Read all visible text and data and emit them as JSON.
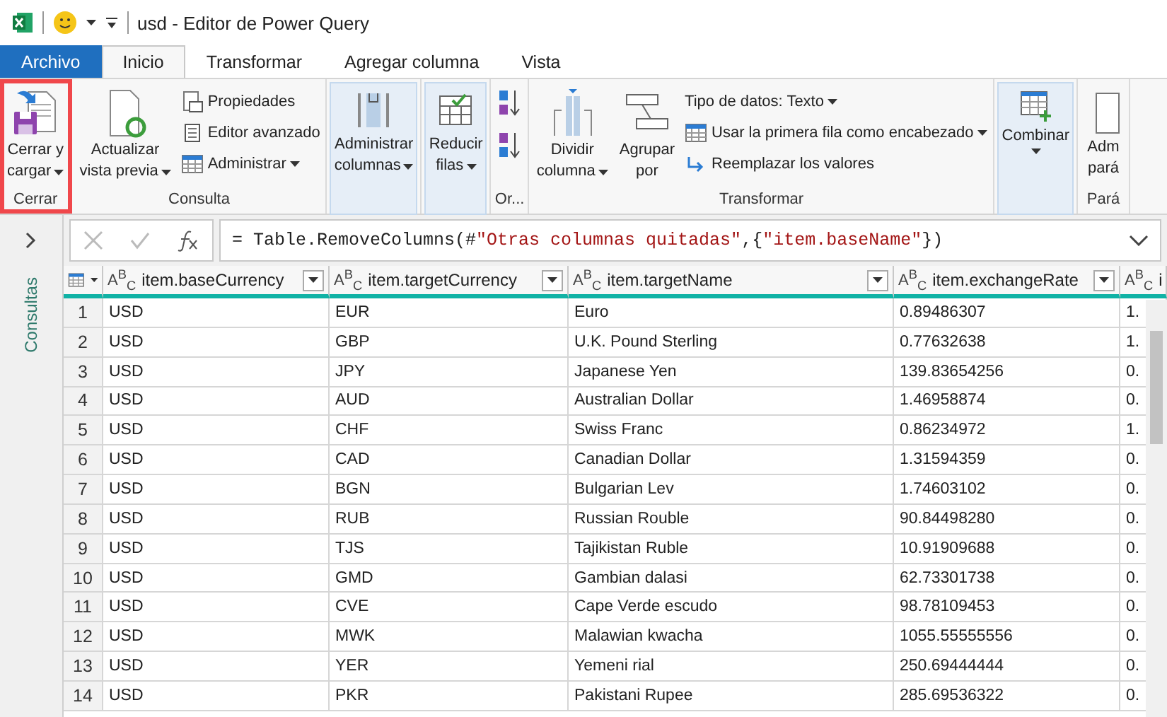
{
  "window": {
    "title": "usd - Editor de Power Query"
  },
  "tabs": [
    {
      "label": "Archivo",
      "kind": "file",
      "selected": false
    },
    {
      "label": "Inicio",
      "kind": "tab",
      "selected": true
    },
    {
      "label": "Transformar",
      "kind": "tab",
      "selected": false
    },
    {
      "label": "Agregar columna",
      "kind": "tab",
      "selected": false
    },
    {
      "label": "Vista",
      "kind": "tab",
      "selected": false
    }
  ],
  "ribbon": {
    "groups": [
      {
        "label": "Cerrar",
        "highlighted": true,
        "kind": "normal",
        "buttons": [
          {
            "kind": "large",
            "lines": [
              "Cerrar y",
              "cargar"
            ],
            "dropdown": true
          }
        ]
      },
      {
        "label": "Consulta",
        "highlighted": false,
        "kind": "normal",
        "buttons": [
          {
            "kind": "large",
            "lines": [
              "Actualizar",
              "vista previa"
            ],
            "dropdown": true
          },
          {
            "kind": "small",
            "label": "Propiedades",
            "dropdown": false
          },
          {
            "kind": "small",
            "label": "Editor avanzado",
            "dropdown": false
          },
          {
            "kind": "small",
            "label": "Administrar",
            "dropdown": true
          }
        ]
      },
      {
        "highlighted": false,
        "kind": "collapsed",
        "buttons": [
          {
            "kind": "large",
            "lines": [
              "Administrar",
              "columnas"
            ],
            "dropdown": true
          }
        ]
      },
      {
        "highlighted": false,
        "kind": "collapsed",
        "buttons": [
          {
            "kind": "large",
            "lines": [
              "Reducir",
              "filas"
            ],
            "dropdown": true
          }
        ]
      },
      {
        "label": "Or...",
        "highlighted": false,
        "kind": "normal",
        "buttons": [
          {
            "kind": "icon"
          },
          {
            "kind": "icon"
          }
        ]
      },
      {
        "label": "Transformar",
        "highlighted": false,
        "kind": "normal",
        "buttons": [
          {
            "kind": "large",
            "lines": [
              "Dividir",
              "columna"
            ],
            "dropdown": true
          },
          {
            "kind": "large",
            "lines": [
              "Agrupar",
              "por"
            ],
            "dropdown": false
          },
          {
            "kind": "small",
            "label": "Tipo de datos: Texto",
            "dropdown": true
          },
          {
            "kind": "small",
            "label": "Usar la primera fila como encabezado",
            "dropdown": true
          },
          {
            "kind": "small",
            "label": "Reemplazar los valores",
            "dropdown": false
          }
        ]
      },
      {
        "highlighted": false,
        "kind": "collapsed",
        "buttons": [
          {
            "kind": "large",
            "lines": [
              "Combinar"
            ],
            "dropdown": true
          }
        ]
      },
      {
        "label": "Pará",
        "highlighted": false,
        "kind": "normal",
        "buttons": [
          {
            "kind": "large",
            "lines": [
              "Adm",
              "pará"
            ],
            "dropdown": false
          }
        ]
      }
    ]
  },
  "sidebar": {
    "label": "Consultas"
  },
  "formula": {
    "tokens": [
      {
        "kind": "code",
        "text": "= Table.RemoveColumns(#"
      },
      {
        "kind": "string",
        "text": "\"Otras columnas quitadas\""
      },
      {
        "kind": "code",
        "text": ",{"
      },
      {
        "kind": "string",
        "text": "\"item.baseName\""
      },
      {
        "kind": "code",
        "text": "})"
      }
    ]
  },
  "table": {
    "columns": [
      {
        "type": "A$^{B}$$_{C}$",
        "name": "item.baseCurrency"
      },
      {
        "type": "A$^{B}$$_{C}$",
        "name": "item.targetCurrency"
      },
      {
        "type": "A$^{B}$$_{C}$",
        "name": "item.targetName"
      },
      {
        "type": "A$^{B}$$_{C}$",
        "name": "item.exchangeRate"
      },
      {
        "type": "A$^{B}$$_{C}$",
        "name": "i"
      }
    ],
    "rows": [
      {
        "n": "1",
        "cells": [
          "USD",
          "EUR",
          "Euro",
          "0.89486307",
          "1."
        ]
      },
      {
        "n": "2",
        "cells": [
          "USD",
          "GBP",
          "U.K. Pound Sterling",
          "0.77632638",
          "1."
        ]
      },
      {
        "n": "3",
        "cells": [
          "USD",
          "JPY",
          "Japanese Yen",
          "139.83654256",
          "0."
        ]
      },
      {
        "n": "4",
        "cells": [
          "USD",
          "AUD",
          "Australian Dollar",
          "1.46958874",
          "0."
        ]
      },
      {
        "n": "5",
        "cells": [
          "USD",
          "CHF",
          "Swiss Franc",
          "0.86234972",
          "1."
        ]
      },
      {
        "n": "6",
        "cells": [
          "USD",
          "CAD",
          "Canadian Dollar",
          "1.31594359",
          "0."
        ]
      },
      {
        "n": "7",
        "cells": [
          "USD",
          "BGN",
          "Bulgarian Lev",
          "1.74603102",
          "0."
        ]
      },
      {
        "n": "8",
        "cells": [
          "USD",
          "RUB",
          "Russian Rouble",
          "90.84498280",
          "0."
        ]
      },
      {
        "n": "9",
        "cells": [
          "USD",
          "TJS",
          "Tajikistan Ruble",
          "10.91909688",
          "0."
        ]
      },
      {
        "n": "10",
        "cells": [
          "USD",
          "GMD",
          "Gambian dalasi",
          "62.73301738",
          "0."
        ]
      },
      {
        "n": "11",
        "cells": [
          "USD",
          "CVE",
          "Cape Verde escudo",
          "98.78109453",
          "0."
        ]
      },
      {
        "n": "12",
        "cells": [
          "USD",
          "MWK",
          "Malawian kwacha",
          "1055.55555556",
          "0."
        ]
      },
      {
        "n": "13",
        "cells": [
          "USD",
          "YER",
          "Yemeni rial",
          "250.69444444",
          "0."
        ]
      },
      {
        "n": "14",
        "cells": [
          "USD",
          "PKR",
          "Pakistani Rupee",
          "285.69536322",
          "0."
        ]
      }
    ]
  }
}
